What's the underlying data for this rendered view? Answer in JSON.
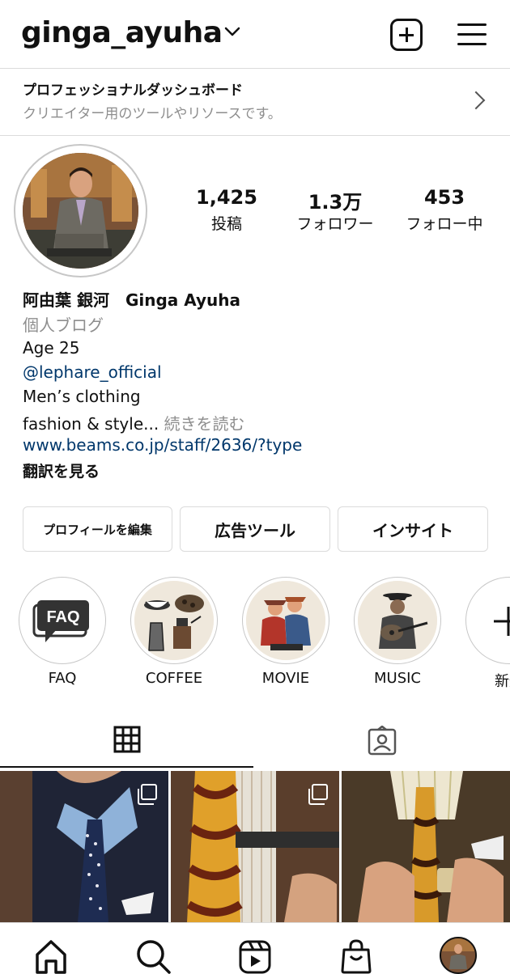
{
  "header": {
    "username": "ginga_ayuha"
  },
  "dashboard": {
    "title": "プロフェッショナルダッシュボード",
    "subtitle": "クリエイター用のツールやリソースです。"
  },
  "stats": [
    {
      "value": "1,425",
      "label": "投稿"
    },
    {
      "value": "1.3万",
      "label": "フォロワー"
    },
    {
      "value": "453",
      "label": "フォロー中"
    }
  ],
  "profile": {
    "name": "阿由葉 銀河　Ginga Ayuha",
    "category": "個人ブログ",
    "bio_line1": "Age 25",
    "mention": "@lephare_official",
    "bio_line2": "Men’s clothing",
    "bio_line3": "fashion & style...",
    "more": " 続きを読む",
    "link": "www.beams.co.jp/staff/2636/?type",
    "translate": "翻訳を見る"
  },
  "buttons": {
    "edit": "プロフィールを編集",
    "ads": "広告ツール",
    "insights": "インサイト"
  },
  "highlights": [
    {
      "label": "FAQ"
    },
    {
      "label": "COFFEE"
    },
    {
      "label": "MOVIE"
    },
    {
      "label": "MUSIC"
    },
    {
      "label": "新規"
    }
  ],
  "highlight_faq_icon_text": "FAQ",
  "icons": {
    "chevron": "chevron-down-icon",
    "create": "plus-square-icon",
    "menu": "hamburger-menu-icon",
    "grid_tab": "grid-icon",
    "tagged_tab": "tagged-person-icon",
    "home": "home-icon",
    "search": "search-icon",
    "reels": "reels-icon",
    "shop": "shopping-bag-icon"
  }
}
